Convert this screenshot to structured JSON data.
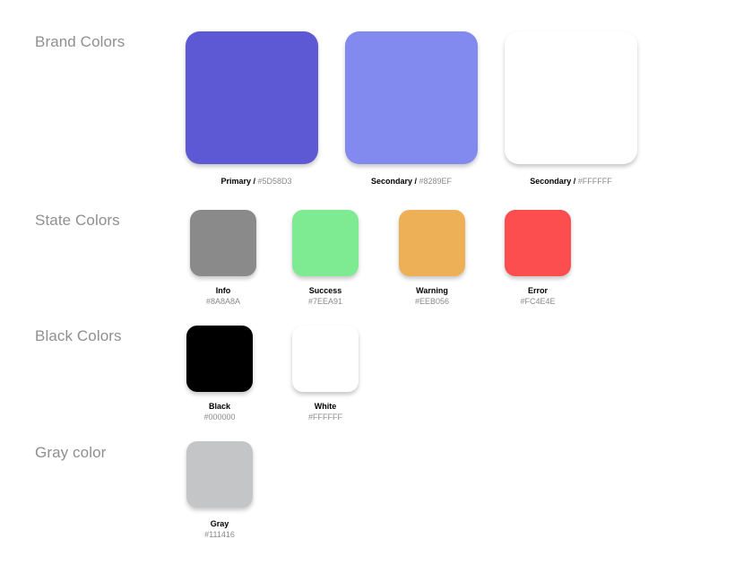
{
  "sections": {
    "brand": {
      "title": "Brand Colors",
      "items": [
        {
          "name": "Primary",
          "hex": "#5D58D3",
          "color": "#5D58D3"
        },
        {
          "name": "Secondary",
          "hex": "#8289EF",
          "color": "#8289EF"
        },
        {
          "name": "Secondary",
          "hex": "#FFFFFF",
          "color": "#FFFFFF"
        }
      ]
    },
    "state": {
      "title": "State Colors",
      "items": [
        {
          "name": "Info",
          "hex": "#8A8A8A",
          "color": "#8A8A8A"
        },
        {
          "name": "Success",
          "hex": "#7EEA91",
          "color": "#7EEA91"
        },
        {
          "name": "Warning",
          "hex": "#EEB056",
          "color": "#EEB056"
        },
        {
          "name": "Error",
          "hex": "#FC4E4E",
          "color": "#FC4E4E"
        }
      ]
    },
    "black": {
      "title": "Black Colors",
      "items": [
        {
          "name": "Black",
          "hex": "#000000",
          "color": "#000000"
        },
        {
          "name": "White",
          "hex": "#FFFFFF",
          "color": "#FFFFFF"
        }
      ]
    },
    "gray": {
      "title": "Gray color",
      "items": [
        {
          "name": "Gray",
          "hex": "#111416",
          "color": "#C4C5C7"
        }
      ]
    }
  },
  "separator": " / "
}
